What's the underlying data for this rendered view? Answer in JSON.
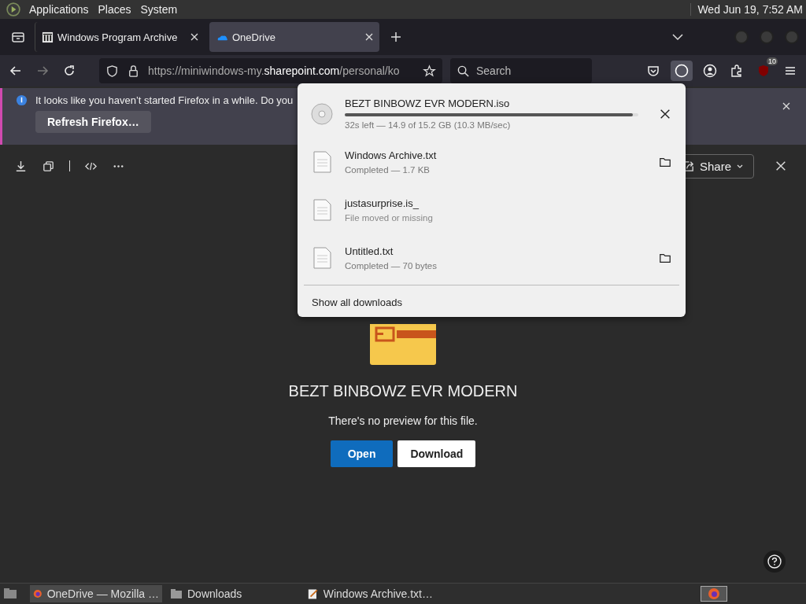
{
  "top_panel": {
    "menus": [
      "Applications",
      "Places",
      "System"
    ],
    "clock": "Wed Jun 19, 7:52 AM"
  },
  "tabs": [
    {
      "title": "Windows Program Archive",
      "selected": false
    },
    {
      "title": "OneDrive",
      "selected": true
    }
  ],
  "toolbar": {
    "url": {
      "before": "https://miniwindows-my.",
      "domain": "sharepoint.com",
      "after": "/personal/ko"
    },
    "search": {
      "placeholder": "Search"
    },
    "extension_badge": "10"
  },
  "notification": {
    "text": "It looks like you haven’t started Firefox in a while. Do you",
    "button": "Refresh Firefox…"
  },
  "downloads": {
    "items": [
      {
        "kind": "progress",
        "name": "BEZT BINBOWZ EVR MODERN.iso",
        "status": "32s left — 14.9 of 15.2 GB (10.3 MB/sec)",
        "level": 0.98
      },
      {
        "kind": "done",
        "name": "Windows Archive.txt",
        "status": "Completed — 1.7 KB"
      },
      {
        "kind": "missing",
        "name": "justasurprise.is_",
        "status": "File moved or missing"
      },
      {
        "kind": "done",
        "name": "Untitled.txt",
        "status": "Completed — 70 bytes"
      }
    ],
    "show_all": "Show all downloads"
  },
  "viewer": {
    "share": "Share",
    "title": "BEZT BINBOWZ EVR MODERN",
    "message": "There's no preview for this file.",
    "buttons": [
      {
        "kind": "primary",
        "label": "Open"
      },
      {
        "kind": "secondary",
        "label": "Download"
      }
    ]
  },
  "taskbar": [
    {
      "kind": "browser",
      "label": "OneDrive — Mozilla …",
      "selected": true
    },
    {
      "kind": "folder",
      "label": "Downloads",
      "selected": false
    },
    {
      "kind": "editor",
      "label": "Windows Archive.txt…",
      "selected": false
    }
  ]
}
